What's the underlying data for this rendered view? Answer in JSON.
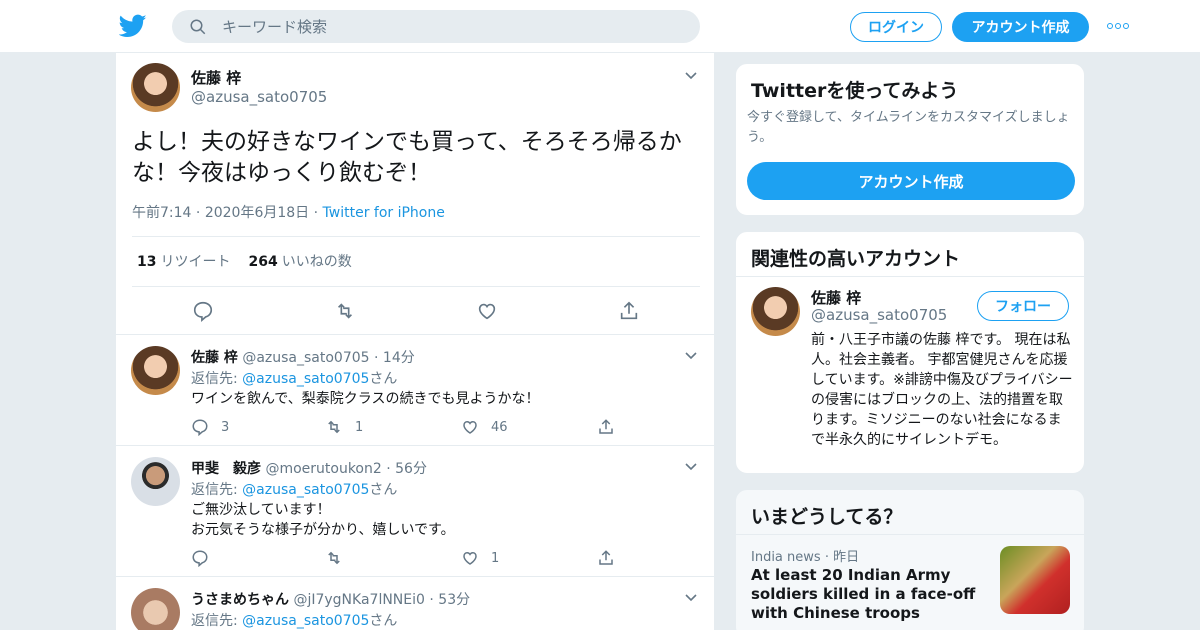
{
  "colors": {
    "accent": "#1da1f2",
    "link": "#1b95e0",
    "muted": "#657786",
    "text": "#14171a",
    "background": "#e6ecf0"
  },
  "header": {
    "logo_icon": "twitter-bird-icon",
    "search": {
      "placeholder": "キーワード検索"
    },
    "login_label": "ログイン",
    "signup_label": "アカウント作成",
    "more_icon": "more-dots-icon"
  },
  "main_tweet": {
    "name": "佐藤 梓",
    "handle": "@azusa_sato0705",
    "text": "よし！夫の好きなワインでも買って、そろそろ帰るかな！今夜はゆっくり飲むぞ！",
    "time": "午前7:14",
    "date": "2020年6月18日",
    "source": "Twitter for iPhone",
    "retweets_count": "13",
    "retweets_label": "リツイート",
    "likes_count": "264",
    "likes_label": "いいねの数"
  },
  "replies": [
    {
      "name": "佐藤 梓",
      "handle": "@azusa_sato0705",
      "time": "14分",
      "reply_to_label": "返信先:",
      "reply_to_handle": "@azusa_sato0705",
      "reply_to_suffix": "さん",
      "text_lines": [
        "ワインを飲んで、梨泰院クラスの続きでも見ようかな！"
      ],
      "reply_count": "3",
      "retweet_count": "1",
      "like_count": "46"
    },
    {
      "name": "甲斐　毅彦",
      "handle": "@moerutoukon2",
      "time": "56分",
      "reply_to_label": "返信先:",
      "reply_to_handle": "@azusa_sato0705",
      "reply_to_suffix": "さん",
      "text_lines": [
        "ご無沙汰しています！",
        "お元気そうな様子が分かり、嬉しいです。"
      ],
      "reply_count": "",
      "retweet_count": "",
      "like_count": "1"
    },
    {
      "name": "うさまめちゃん",
      "handle": "@jI7ygNKa7lNNEi0",
      "time": "53分",
      "reply_to_label": "返信先:",
      "reply_to_handle": "@azusa_sato0705",
      "reply_to_suffix": "さん"
    }
  ],
  "sidebar": {
    "signup_card": {
      "title": "Twitterを使ってみよう",
      "subtitle": "今すぐ登録して、タイムラインをカスタマイズしましょう。",
      "button_label": "アカウント作成"
    },
    "related_card": {
      "title": "関連性の高いアカウント",
      "name": "佐藤 梓",
      "handle": "@azusa_sato0705",
      "follow_label": "フォロー",
      "bio": "前・八王子市議の佐藤 梓です。 現在は私人。社会主義者。 宇都宮健児さんを応援しています。※誹謗中傷及びプライバシーの侵害にはブロックの上、法的措置を取ります。ミソジニーのない社会になるまで半永久的にサイレントデモ。"
    },
    "trends_card": {
      "title": "いまどうしてる？",
      "source": "India news",
      "when": "昨日",
      "headline": "At least 20 Indian Army soldiers killed in a face-off with Chinese troops"
    }
  }
}
